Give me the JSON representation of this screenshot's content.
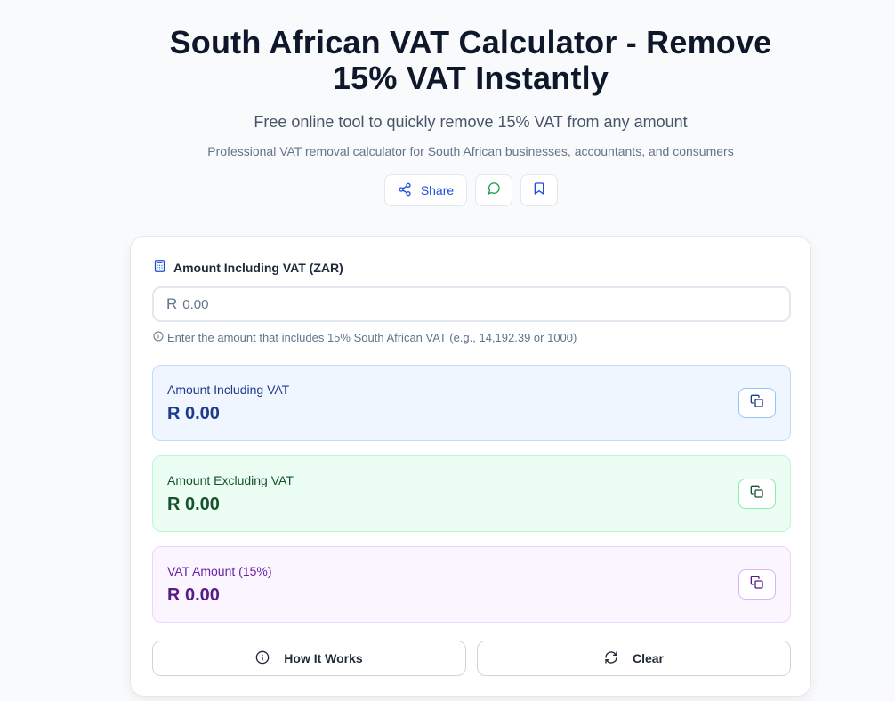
{
  "header": {
    "title": "South African VAT Calculator - Remove 15% VAT Instantly",
    "subtitle": "Free online tool to quickly remove 15% VAT from any amount",
    "tagline": "Professional VAT removal calculator for South African businesses, accountants, and consumers",
    "share_label": "Share"
  },
  "form": {
    "label": "Amount Including VAT (ZAR)",
    "currency_prefix": "R",
    "placeholder": "0.00",
    "value": "",
    "hint": "Enter the amount that includes 15% South African VAT (e.g., 14,192.39 or 1000)"
  },
  "results": [
    {
      "label": "Amount Including VAT",
      "value": "R 0.00"
    },
    {
      "label": "Amount Excluding VAT",
      "value": "R 0.00"
    },
    {
      "label": "VAT Amount (15%)",
      "value": "R 0.00"
    }
  ],
  "buttons": {
    "how_it_works": "How It Works",
    "clear": "Clear"
  },
  "icons": {
    "share": "share-icon",
    "whatsapp": "message-circle-icon",
    "bookmark": "bookmark-icon",
    "calculator": "calculator-icon",
    "info": "info-icon",
    "copy": "copy-icon",
    "refresh": "refresh-icon"
  },
  "colors": {
    "blue_accent": "#1e3a8a",
    "green_accent": "#14532d",
    "purple_accent": "#581c87"
  }
}
